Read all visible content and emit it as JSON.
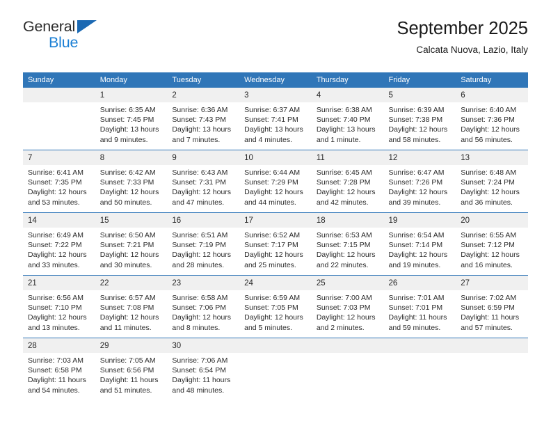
{
  "brand": {
    "name_top": "General",
    "name_bottom": "Blue",
    "triangle_color": "#1b69b3",
    "blue_text_color": "#1b7fd4"
  },
  "header": {
    "title": "September 2025",
    "subtitle": "Calcata Nuova, Lazio, Italy"
  },
  "theme": {
    "header_bg": "#3076b8",
    "daynum_bg": "#f0f0f0",
    "text": "#2a2a2a"
  },
  "weekday_headers": [
    "Sunday",
    "Monday",
    "Tuesday",
    "Wednesday",
    "Thursday",
    "Friday",
    "Saturday"
  ],
  "weeks": [
    [
      {
        "day": "",
        "sunrise": "",
        "sunset": "",
        "daylight": "",
        "empty": true
      },
      {
        "day": "1",
        "sunrise": "Sunrise: 6:35 AM",
        "sunset": "Sunset: 7:45 PM",
        "daylight": "Daylight: 13 hours and 9 minutes."
      },
      {
        "day": "2",
        "sunrise": "Sunrise: 6:36 AM",
        "sunset": "Sunset: 7:43 PM",
        "daylight": "Daylight: 13 hours and 7 minutes."
      },
      {
        "day": "3",
        "sunrise": "Sunrise: 6:37 AM",
        "sunset": "Sunset: 7:41 PM",
        "daylight": "Daylight: 13 hours and 4 minutes."
      },
      {
        "day": "4",
        "sunrise": "Sunrise: 6:38 AM",
        "sunset": "Sunset: 7:40 PM",
        "daylight": "Daylight: 13 hours and 1 minute."
      },
      {
        "day": "5",
        "sunrise": "Sunrise: 6:39 AM",
        "sunset": "Sunset: 7:38 PM",
        "daylight": "Daylight: 12 hours and 58 minutes."
      },
      {
        "day": "6",
        "sunrise": "Sunrise: 6:40 AM",
        "sunset": "Sunset: 7:36 PM",
        "daylight": "Daylight: 12 hours and 56 minutes."
      }
    ],
    [
      {
        "day": "7",
        "sunrise": "Sunrise: 6:41 AM",
        "sunset": "Sunset: 7:35 PM",
        "daylight": "Daylight: 12 hours and 53 minutes."
      },
      {
        "day": "8",
        "sunrise": "Sunrise: 6:42 AM",
        "sunset": "Sunset: 7:33 PM",
        "daylight": "Daylight: 12 hours and 50 minutes."
      },
      {
        "day": "9",
        "sunrise": "Sunrise: 6:43 AM",
        "sunset": "Sunset: 7:31 PM",
        "daylight": "Daylight: 12 hours and 47 minutes."
      },
      {
        "day": "10",
        "sunrise": "Sunrise: 6:44 AM",
        "sunset": "Sunset: 7:29 PM",
        "daylight": "Daylight: 12 hours and 44 minutes."
      },
      {
        "day": "11",
        "sunrise": "Sunrise: 6:45 AM",
        "sunset": "Sunset: 7:28 PM",
        "daylight": "Daylight: 12 hours and 42 minutes."
      },
      {
        "day": "12",
        "sunrise": "Sunrise: 6:47 AM",
        "sunset": "Sunset: 7:26 PM",
        "daylight": "Daylight: 12 hours and 39 minutes."
      },
      {
        "day": "13",
        "sunrise": "Sunrise: 6:48 AM",
        "sunset": "Sunset: 7:24 PM",
        "daylight": "Daylight: 12 hours and 36 minutes."
      }
    ],
    [
      {
        "day": "14",
        "sunrise": "Sunrise: 6:49 AM",
        "sunset": "Sunset: 7:22 PM",
        "daylight": "Daylight: 12 hours and 33 minutes."
      },
      {
        "day": "15",
        "sunrise": "Sunrise: 6:50 AM",
        "sunset": "Sunset: 7:21 PM",
        "daylight": "Daylight: 12 hours and 30 minutes."
      },
      {
        "day": "16",
        "sunrise": "Sunrise: 6:51 AM",
        "sunset": "Sunset: 7:19 PM",
        "daylight": "Daylight: 12 hours and 28 minutes."
      },
      {
        "day": "17",
        "sunrise": "Sunrise: 6:52 AM",
        "sunset": "Sunset: 7:17 PM",
        "daylight": "Daylight: 12 hours and 25 minutes."
      },
      {
        "day": "18",
        "sunrise": "Sunrise: 6:53 AM",
        "sunset": "Sunset: 7:15 PM",
        "daylight": "Daylight: 12 hours and 22 minutes."
      },
      {
        "day": "19",
        "sunrise": "Sunrise: 6:54 AM",
        "sunset": "Sunset: 7:14 PM",
        "daylight": "Daylight: 12 hours and 19 minutes."
      },
      {
        "day": "20",
        "sunrise": "Sunrise: 6:55 AM",
        "sunset": "Sunset: 7:12 PM",
        "daylight": "Daylight: 12 hours and 16 minutes."
      }
    ],
    [
      {
        "day": "21",
        "sunrise": "Sunrise: 6:56 AM",
        "sunset": "Sunset: 7:10 PM",
        "daylight": "Daylight: 12 hours and 13 minutes."
      },
      {
        "day": "22",
        "sunrise": "Sunrise: 6:57 AM",
        "sunset": "Sunset: 7:08 PM",
        "daylight": "Daylight: 12 hours and 11 minutes."
      },
      {
        "day": "23",
        "sunrise": "Sunrise: 6:58 AM",
        "sunset": "Sunset: 7:06 PM",
        "daylight": "Daylight: 12 hours and 8 minutes."
      },
      {
        "day": "24",
        "sunrise": "Sunrise: 6:59 AM",
        "sunset": "Sunset: 7:05 PM",
        "daylight": "Daylight: 12 hours and 5 minutes."
      },
      {
        "day": "25",
        "sunrise": "Sunrise: 7:00 AM",
        "sunset": "Sunset: 7:03 PM",
        "daylight": "Daylight: 12 hours and 2 minutes."
      },
      {
        "day": "26",
        "sunrise": "Sunrise: 7:01 AM",
        "sunset": "Sunset: 7:01 PM",
        "daylight": "Daylight: 11 hours and 59 minutes."
      },
      {
        "day": "27",
        "sunrise": "Sunrise: 7:02 AM",
        "sunset": "Sunset: 6:59 PM",
        "daylight": "Daylight: 11 hours and 57 minutes."
      }
    ],
    [
      {
        "day": "28",
        "sunrise": "Sunrise: 7:03 AM",
        "sunset": "Sunset: 6:58 PM",
        "daylight": "Daylight: 11 hours and 54 minutes."
      },
      {
        "day": "29",
        "sunrise": "Sunrise: 7:05 AM",
        "sunset": "Sunset: 6:56 PM",
        "daylight": "Daylight: 11 hours and 51 minutes."
      },
      {
        "day": "30",
        "sunrise": "Sunrise: 7:06 AM",
        "sunset": "Sunset: 6:54 PM",
        "daylight": "Daylight: 11 hours and 48 minutes."
      },
      {
        "day": "",
        "sunrise": "",
        "sunset": "",
        "daylight": "",
        "empty": true
      },
      {
        "day": "",
        "sunrise": "",
        "sunset": "",
        "daylight": "",
        "empty": true
      },
      {
        "day": "",
        "sunrise": "",
        "sunset": "",
        "daylight": "",
        "empty": true
      },
      {
        "day": "",
        "sunrise": "",
        "sunset": "",
        "daylight": "",
        "empty": true
      }
    ]
  ]
}
